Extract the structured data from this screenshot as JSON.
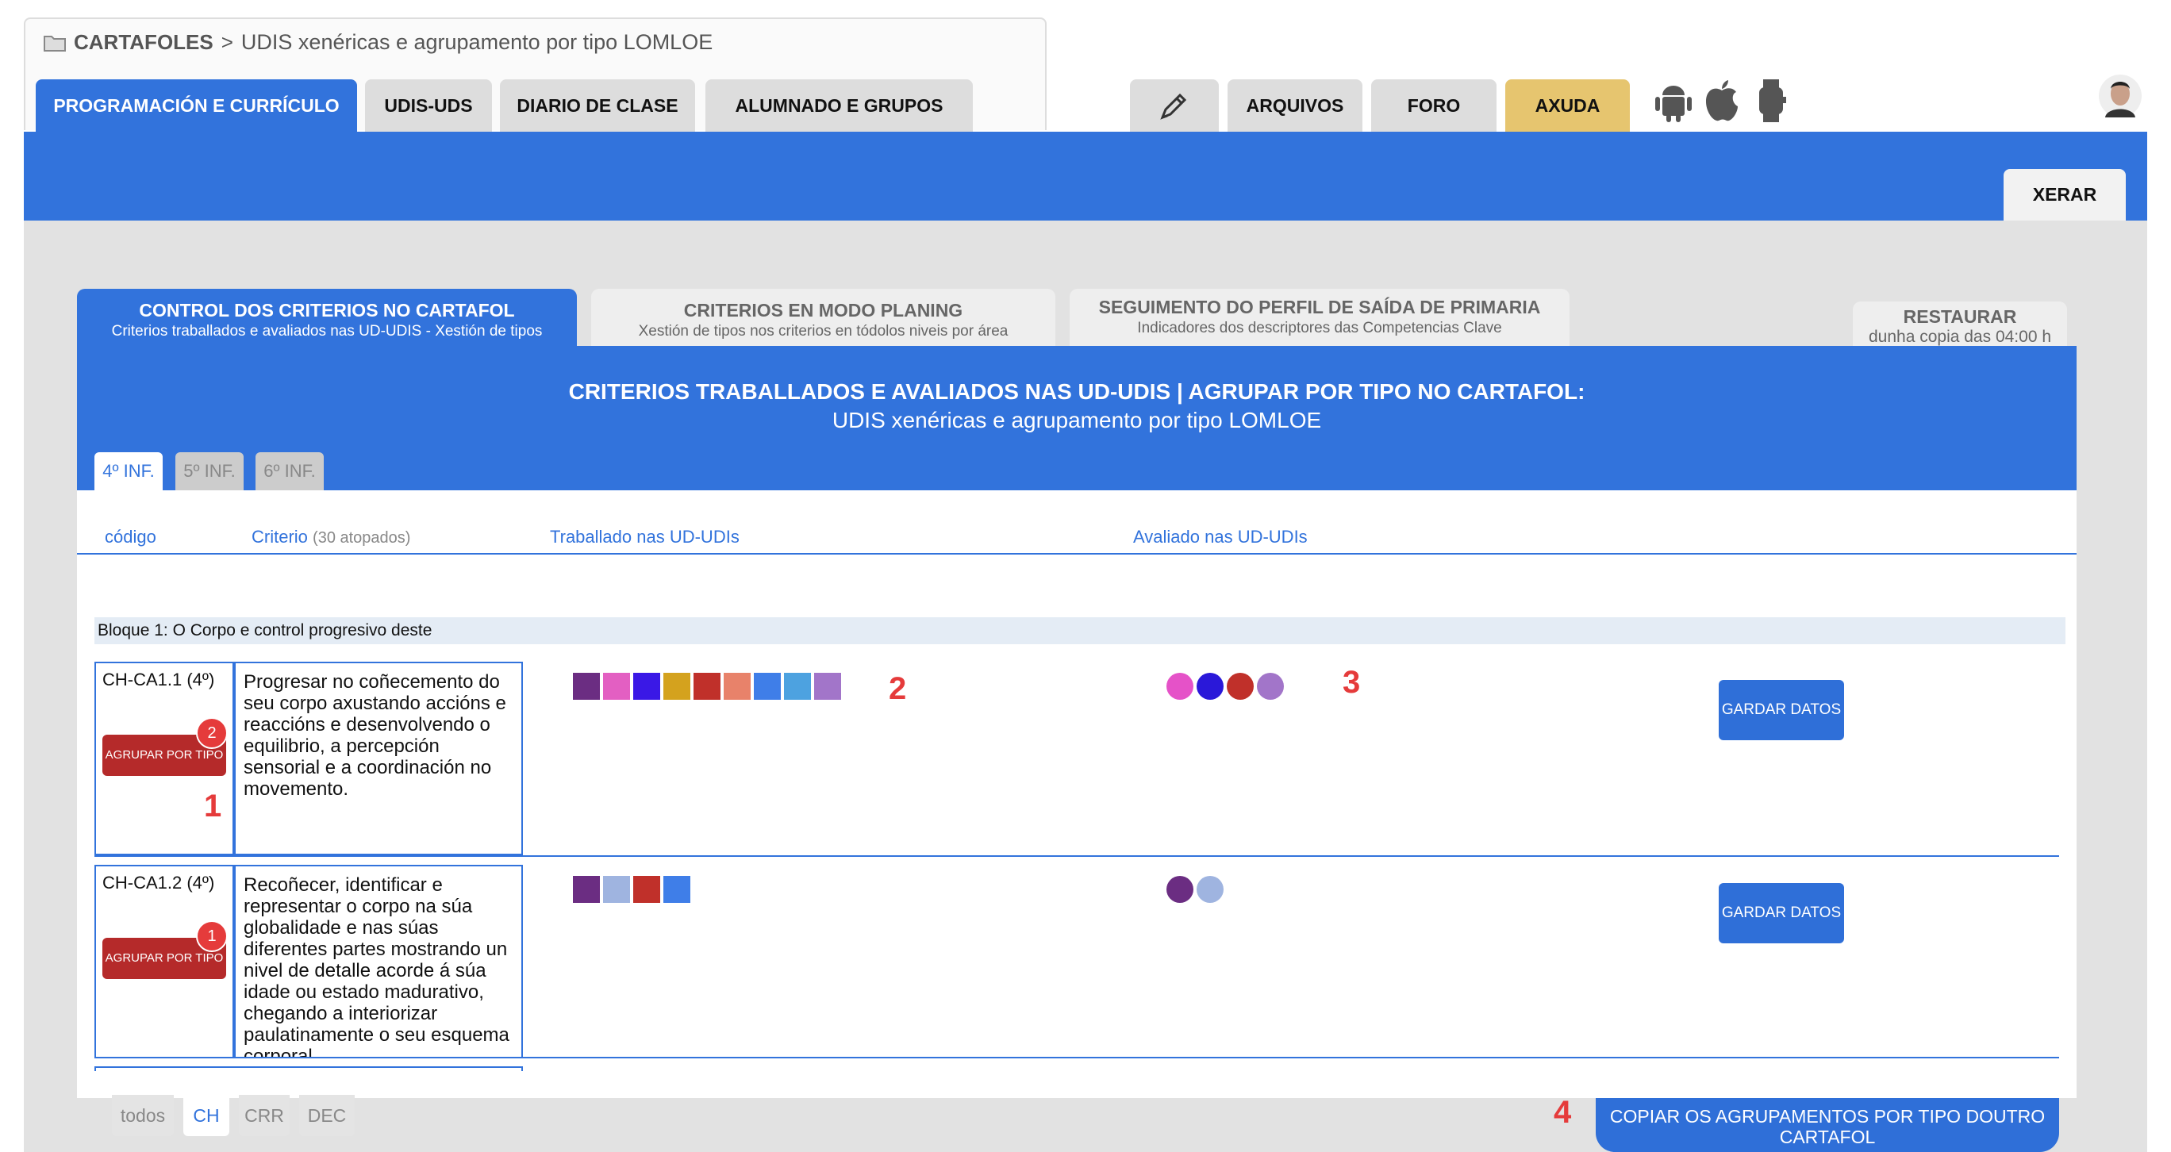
{
  "breadcrumb": {
    "root": "CARTAFOLES",
    "separator": ">",
    "current": "UDIS xenéricas e agrupamento por tipo LOMLOE"
  },
  "main_tabs": [
    {
      "label": "PROGRAMACIÓN E CURRÍCULO",
      "active": true
    },
    {
      "label": "UDIS-UDS"
    },
    {
      "label": "DIARIO DE CLASE"
    },
    {
      "label": "ALUMNADO E GRUPOS"
    }
  ],
  "right_tabs": [
    {
      "label": "ARQUIVOS"
    },
    {
      "label": "FORO"
    },
    {
      "label": "AXUDA",
      "color": "#e6c56f"
    }
  ],
  "icons": [
    "pen-icon",
    "android-icon",
    "apple-icon",
    "watch-icon",
    "user-avatar"
  ],
  "xerar_label": "XERAR",
  "inner_tabs": [
    {
      "title": "CONTROL DOS CRITERIOS NO CARTAFOL",
      "subtitle": "Criterios traballados e avaliados nas UD-UDIS - Xestión de tipos",
      "active": true
    },
    {
      "title": "CRITERIOS EN MODO PLANING",
      "subtitle": "Xestión de tipos nos criterios en tódolos niveis por área"
    },
    {
      "title": "SEGUIMENTO DO PERFIL DE SAÍDA DE PRIMARIA",
      "subtitle": "Indicadores dos descriptores das Competencias Clave"
    },
    {
      "title": "RESTAURAR",
      "subtitle": "dunha copia das 04:00 h"
    }
  ],
  "panel": {
    "title": "CRITERIOS TRABALLADOS E AVALIADOS NAS UD-UDIS | AGRUPAR POR TIPO NO CARTAFOL:",
    "subtitle": "UDIS xenéricas e agrupamento por tipo LOMLOE"
  },
  "grade_tabs": [
    {
      "label": "4º INF.",
      "active": true
    },
    {
      "label": "5º INF."
    },
    {
      "label": "6º INF."
    }
  ],
  "columns": {
    "code": "código",
    "criterio": "Criterio",
    "count": "(30 atopados)",
    "traballado": "Traballado nas UD-UDIs",
    "avaliado": "Avaliado nas UD-UDIs"
  },
  "bloque": "Bloque 1: O Corpo e control progresivo deste",
  "rows": [
    {
      "code": "CH-CA1.1 (4º)",
      "text": "Progresar no coñecemento do seu corpo axustando accións e reaccións e desenvolvendo o equilibrio, a percepción sensorial e a coordinación no movemento.",
      "agrupar": "AGRUPAR POR TIPO",
      "badge": "2",
      "squares": [
        "#6b2d82",
        "#e35fc2",
        "#3a18e6",
        "#d4a21e",
        "#c0302a",
        "#e8826a",
        "#3f7ee8",
        "#4da2e0",
        "#a275c9"
      ],
      "dots": [
        "#e552c8",
        "#2a18d9",
        "#c0302a",
        "#a275c9"
      ],
      "gardar": "GARDAR DATOS"
    },
    {
      "code": "CH-CA1.2 (4º)",
      "text": "Recoñecer, identificar e representar o corpo na súa globalidade e nas súas diferentes partes mostrando un nivel de detalle acorde á súa idade ou estado madurativo, chegando a interiorizar paulatinamente o seu esquema corporal.",
      "agrupar": "AGRUPAR POR TIPO",
      "badge": "1",
      "squares": [
        "#6b2d82",
        "#9fb4e0",
        "#c0302a",
        "#3f7ee8"
      ],
      "dots": [
        "#6b2d82",
        "#9fb4e0"
      ],
      "gardar": "GARDAR DATOS"
    }
  ],
  "annotations": {
    "n1": "1",
    "n2": "2",
    "n3": "3",
    "n4": "4"
  },
  "filter_tabs": [
    {
      "label": "todos"
    },
    {
      "label": "CH",
      "active": true
    },
    {
      "label": "CRR"
    },
    {
      "label": "DEC"
    }
  ],
  "copiar_label": "COPIAR OS AGRUPAMENTOS POR TIPO DOUTRO CARTAFOL"
}
